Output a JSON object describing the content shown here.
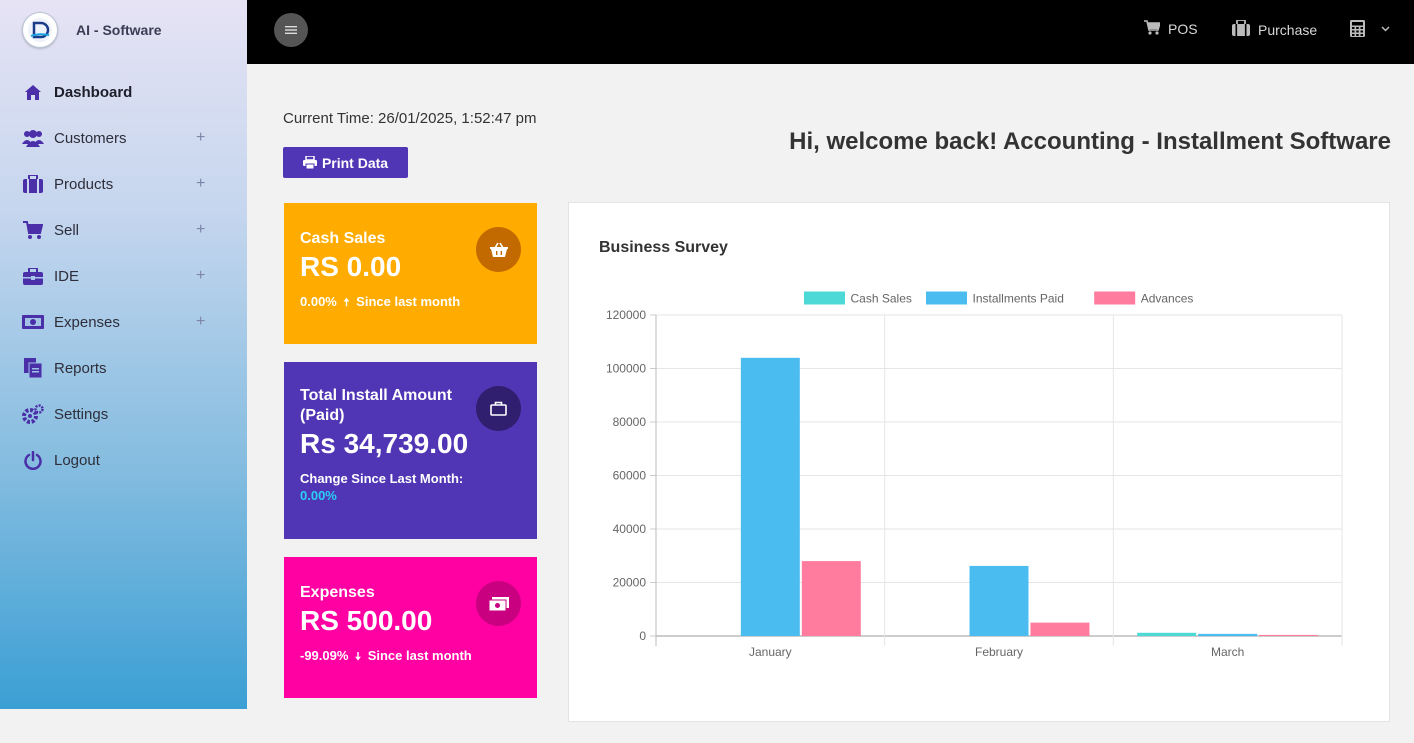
{
  "brand": {
    "name": "AI - Software"
  },
  "sidebar": {
    "items": [
      {
        "label": "Dashboard",
        "icon": "home-icon",
        "expandable": false
      },
      {
        "label": "Customers",
        "icon": "users-icon",
        "expandable": true
      },
      {
        "label": "Products",
        "icon": "briefcase-icon",
        "expandable": true
      },
      {
        "label": "Sell",
        "icon": "cart-icon",
        "expandable": true
      },
      {
        "label": "IDE",
        "icon": "toolbox-icon",
        "expandable": true
      },
      {
        "label": "Expenses",
        "icon": "money-icon",
        "expandable": true
      },
      {
        "label": "Reports",
        "icon": "documents-icon",
        "expandable": false
      },
      {
        "label": "Settings",
        "icon": "cogs-icon",
        "expandable": false
      },
      {
        "label": "Logout",
        "icon": "power-icon",
        "expandable": false
      }
    ]
  },
  "topbar": {
    "pos_label": "POS",
    "purchase_label": "Purchase"
  },
  "main": {
    "current_time": "Current Time: 26/01/2025, 1:52:47 pm",
    "print_label": "Print Data",
    "welcome": "Hi, welcome back! Accounting - Installment Software"
  },
  "cards": {
    "cash": {
      "title": "Cash Sales",
      "value": "RS 0.00",
      "change": "0.00%",
      "arrow": "🠅",
      "since": "Since last month",
      "color": "#ffab00"
    },
    "install": {
      "title": "Total Install Amount (Paid)",
      "value": "Rs 34,739.00",
      "change_label": "Change Since Last Month:",
      "change": "0.00%",
      "color": "#5035b4"
    },
    "expenses": {
      "title": "Expenses",
      "value": "RS 500.00",
      "change": "-99.09%",
      "arrow": "🠇",
      "since": "Since last month",
      "color": "#ff00a2"
    }
  },
  "chart_data": {
    "type": "bar",
    "title": "Business Survey",
    "categories": [
      "January",
      "February",
      "March"
    ],
    "series": [
      {
        "name": "Cash Sales",
        "values": [
          0,
          0,
          1200
        ],
        "color": "#4dd9d5"
      },
      {
        "name": "Installments Paid",
        "values": [
          104000,
          26200,
          800
        ],
        "color": "#4bbcf0"
      },
      {
        "name": "Advances",
        "values": [
          28000,
          5000,
          400
        ],
        "color": "#ff7c9e"
      }
    ],
    "ylim": [
      0,
      120000
    ],
    "yticks": [
      "0",
      "20000",
      "40000",
      "60000",
      "80000",
      "100000",
      "120000"
    ],
    "legend_position": "top",
    "grid": true
  }
}
